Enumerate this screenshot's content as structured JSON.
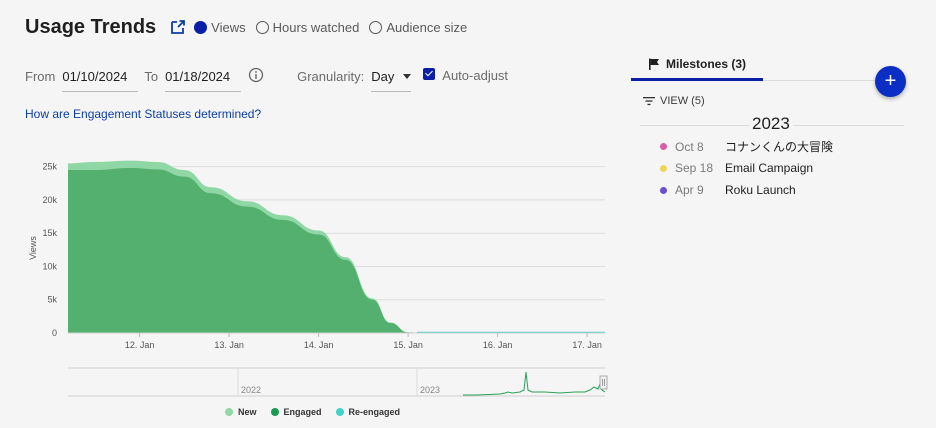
{
  "header": {
    "title": "Usage Trends",
    "metrics": [
      {
        "label": "Views",
        "selected": true
      },
      {
        "label": "Hours watched",
        "selected": false
      },
      {
        "label": "Audience size",
        "selected": false
      }
    ]
  },
  "filters": {
    "from_label": "From",
    "from_value": "01/10/2024",
    "to_label": "To",
    "to_value": "01/18/2024",
    "granularity_label": "Granularity:",
    "granularity_value": "Day",
    "auto_adjust_label": "Auto-adjust",
    "auto_adjust_checked": true
  },
  "help_link": "How are Engagement Statuses determined?",
  "chart_data": {
    "type": "area",
    "ylabel": "Views",
    "xlabel": "",
    "yticks": [
      "25k",
      "20k",
      "15k",
      "10k",
      "5k",
      "0"
    ],
    "ylim": [
      0,
      26000
    ],
    "xticks": [
      "12. Jan",
      "13. Jan",
      "14. Jan",
      "15. Jan",
      "16. Jan",
      "17. Jan"
    ],
    "x": [
      11.2,
      11.5,
      11.9,
      12.2,
      12.5,
      12.8,
      13.2,
      13.6,
      14.0,
      14.3,
      14.6,
      14.8,
      15.0,
      15.2,
      15.5,
      16.0,
      16.5,
      17.0,
      17.2
    ],
    "series": [
      {
        "name": "Engaged",
        "color": "#53b06f",
        "values": [
          24500,
          24500,
          24800,
          24600,
          23500,
          21000,
          19000,
          17000,
          14800,
          11000,
          5000,
          1500,
          100,
          0,
          0,
          0,
          0,
          0,
          0
        ]
      },
      {
        "name": "New",
        "color": "#8fd8a5",
        "values": [
          1000,
          1200,
          1100,
          1100,
          1000,
          900,
          800,
          700,
          600,
          400,
          200,
          100,
          0,
          0,
          0,
          0,
          0,
          0,
          0
        ]
      },
      {
        "name": "Re-engaged",
        "color": "#3fd4c8",
        "values": [
          0,
          0,
          0,
          0,
          0,
          0,
          0,
          0,
          0,
          0,
          0,
          0,
          0,
          0,
          0,
          0,
          0,
          0,
          0
        ]
      }
    ],
    "navigator": {
      "labels": [
        "2022",
        "2023"
      ]
    },
    "grid": true,
    "legend": "bottom-center"
  },
  "legend": [
    {
      "label": "New",
      "color": "#8fd8a5"
    },
    {
      "label": "Engaged",
      "color": "#1a9a52"
    },
    {
      "label": "Re-engaged",
      "color": "#3fd4c8"
    }
  ],
  "panel": {
    "tab_label": "Milestones (3)",
    "view_label": "VIEW (5)",
    "year": "2023",
    "milestones": [
      {
        "date": "Oct 8",
        "name": "コナンくんの大冒険",
        "color": "#d95ca6"
      },
      {
        "date": "Sep 18",
        "name": "Email Campaign",
        "color": "#f2d35a"
      },
      {
        "date": "Apr 9",
        "name": "Roku Launch",
        "color": "#6a4fd1"
      }
    ]
  }
}
